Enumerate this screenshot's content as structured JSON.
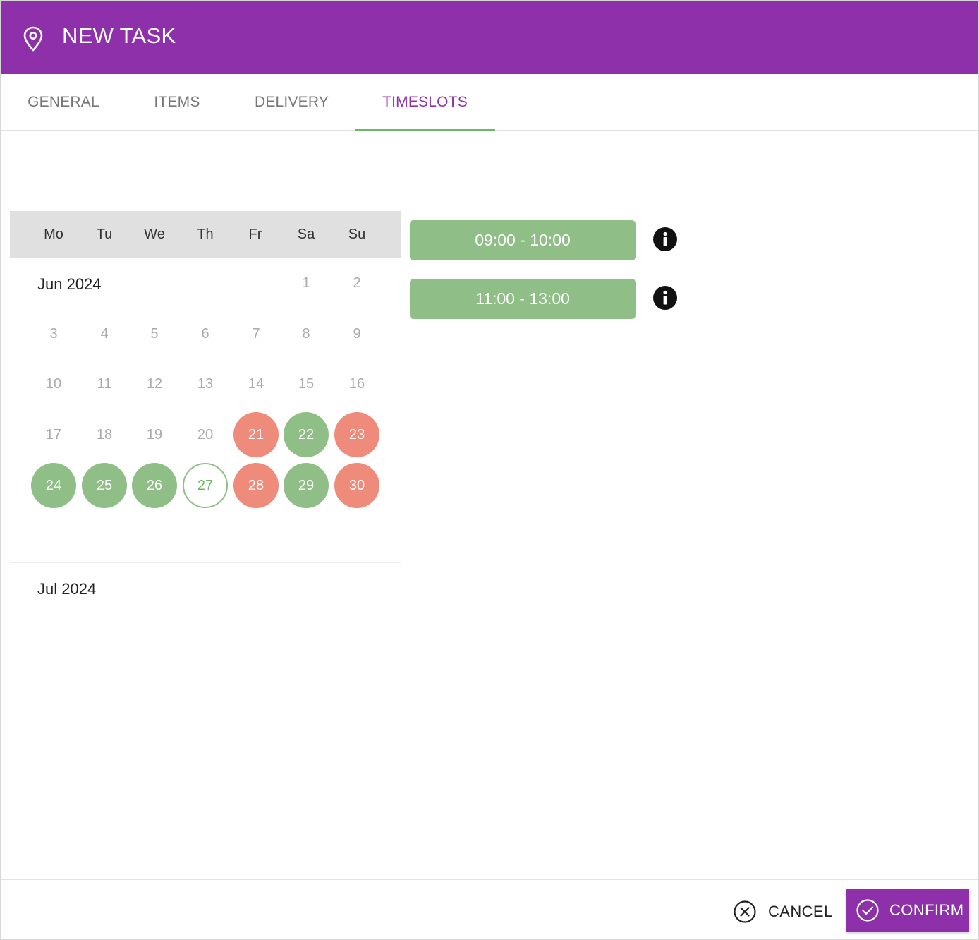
{
  "header": {
    "title": "NEW TASK",
    "icon": "map-pin-icon"
  },
  "tabs": [
    {
      "label": "GENERAL",
      "active": false
    },
    {
      "label": "ITEMS",
      "active": false
    },
    {
      "label": "DELIVERY",
      "active": false
    },
    {
      "label": "TIMESLOTS",
      "active": true
    }
  ],
  "calendar": {
    "weekdays": [
      "Mo",
      "Tu",
      "We",
      "Th",
      "Fr",
      "Sa",
      "Su"
    ],
    "months": [
      {
        "label": "Jun 2024",
        "days": [
          {
            "n": "1",
            "state": "disabled"
          },
          {
            "n": "2",
            "state": "disabled"
          },
          {
            "n": "3",
            "state": "disabled"
          },
          {
            "n": "4",
            "state": "disabled"
          },
          {
            "n": "5",
            "state": "disabled"
          },
          {
            "n": "6",
            "state": "disabled"
          },
          {
            "n": "7",
            "state": "disabled"
          },
          {
            "n": "8",
            "state": "disabled"
          },
          {
            "n": "9",
            "state": "disabled"
          },
          {
            "n": "10",
            "state": "disabled"
          },
          {
            "n": "11",
            "state": "disabled"
          },
          {
            "n": "12",
            "state": "disabled"
          },
          {
            "n": "13",
            "state": "disabled"
          },
          {
            "n": "14",
            "state": "disabled"
          },
          {
            "n": "15",
            "state": "disabled"
          },
          {
            "n": "16",
            "state": "disabled"
          },
          {
            "n": "17",
            "state": "disabled"
          },
          {
            "n": "18",
            "state": "disabled"
          },
          {
            "n": "19",
            "state": "disabled"
          },
          {
            "n": "20",
            "state": "disabled"
          },
          {
            "n": "21",
            "state": "unavailable"
          },
          {
            "n": "22",
            "state": "available"
          },
          {
            "n": "23",
            "state": "unavailable"
          },
          {
            "n": "24",
            "state": "available"
          },
          {
            "n": "25",
            "state": "available"
          },
          {
            "n": "26",
            "state": "available"
          },
          {
            "n": "27",
            "state": "selected"
          },
          {
            "n": "28",
            "state": "unavailable"
          },
          {
            "n": "29",
            "state": "available"
          },
          {
            "n": "30",
            "state": "unavailable"
          }
        ]
      },
      {
        "label": "Jul 2024",
        "days": []
      }
    ]
  },
  "timeslots": [
    {
      "label": "09:00 - 10:00",
      "info_icon": "info-icon"
    },
    {
      "label": "11:00 - 13:00",
      "info_icon": "info-icon"
    }
  ],
  "footer": {
    "cancel_label": "CANCEL",
    "confirm_label": "CONFIRM"
  },
  "colors": {
    "primary": "#8e30a9",
    "available": "#8fbf87",
    "unavailable": "#ee8b7a",
    "tab_indicator": "#6fb56a"
  }
}
